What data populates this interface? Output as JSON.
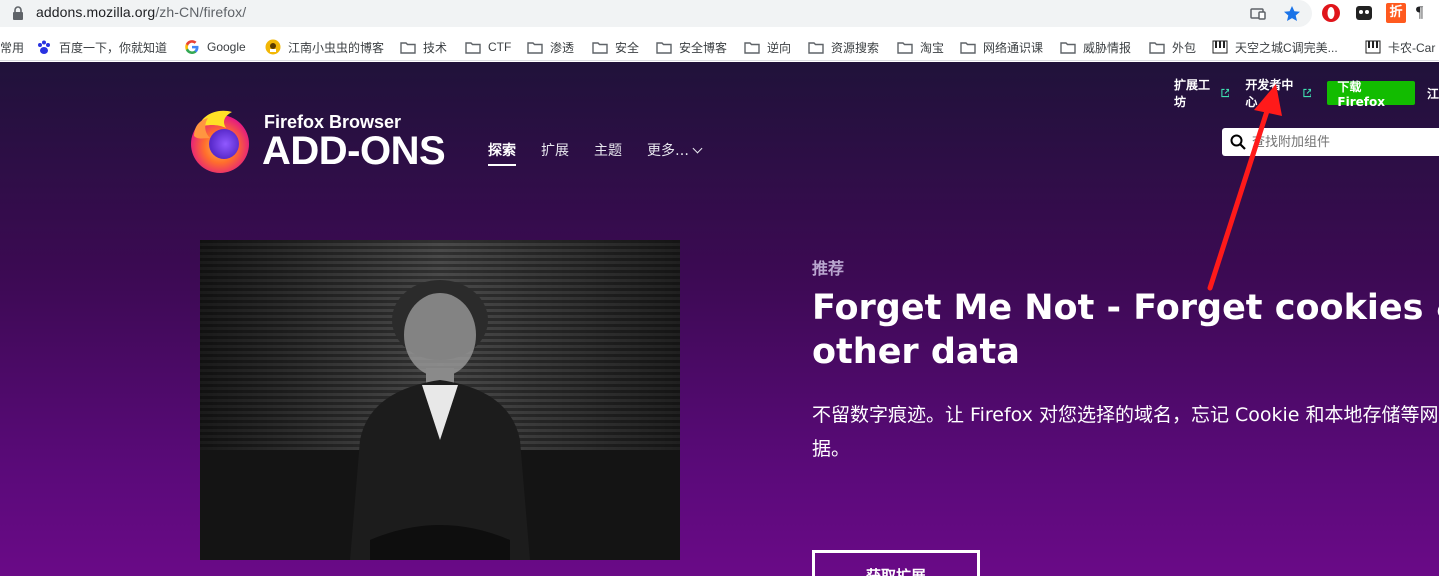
{
  "browser": {
    "url_host": "addons.mozilla.org",
    "url_path": "/zh-CN/firefox/",
    "icons": [
      "lock-icon",
      "cast-icon",
      "bookmark-star-icon",
      "opera-extension-icon",
      "ext-icon-2",
      "ext-icon-3",
      "pilcrow-icon"
    ],
    "ext_labels": {
      "pilcrow": "¶",
      "zhe": "折"
    }
  },
  "bookmarks": [
    {
      "label": "常用",
      "icon": "none"
    },
    {
      "label": "百度一下，你就知道",
      "icon": "baidu-paw-icon"
    },
    {
      "label": "Google",
      "icon": "google-g-icon"
    },
    {
      "label": "江南小虫虫的博客",
      "icon": "avatar-icon"
    },
    {
      "label": "技术",
      "icon": "folder-icon"
    },
    {
      "label": "CTF",
      "icon": "folder-icon"
    },
    {
      "label": "渗透",
      "icon": "folder-icon"
    },
    {
      "label": "安全",
      "icon": "folder-icon"
    },
    {
      "label": "安全博客",
      "icon": "folder-icon"
    },
    {
      "label": "逆向",
      "icon": "folder-icon"
    },
    {
      "label": "资源搜索",
      "icon": "folder-icon"
    },
    {
      "label": "淘宝",
      "icon": "folder-icon"
    },
    {
      "label": "网络通识课",
      "icon": "folder-icon"
    },
    {
      "label": "威胁情报",
      "icon": "folder-icon"
    },
    {
      "label": "外包",
      "icon": "folder-icon"
    },
    {
      "label": "天空之城C调完美...",
      "icon": "piano-icon"
    },
    {
      "label": "卡农-Car",
      "icon": "piano-icon"
    }
  ],
  "header": {
    "toplinks": [
      "扩展工坊",
      "开发者中心"
    ],
    "download_button": "下载 Firefox",
    "edge_char": "江",
    "brand_small": "Firefox Browser",
    "brand_big": "ADD-ONS",
    "nav": [
      "探索",
      "扩展",
      "主题",
      "更多…"
    ],
    "search_placeholder": "查找附加组件"
  },
  "promo": {
    "label": "推荐",
    "title": "Forget Me Not - Forget cookies & other data",
    "description": "不留数字痕迹。让 Firefox 对您选择的域名，忘记 Cookie 和本地存储等网站数据。",
    "button": "获取扩展"
  },
  "colors": {
    "download_green": "#12bc00",
    "annotation_red": "#ff1a1a",
    "page_top": "#20123a",
    "page_bottom": "#6a0a87"
  }
}
